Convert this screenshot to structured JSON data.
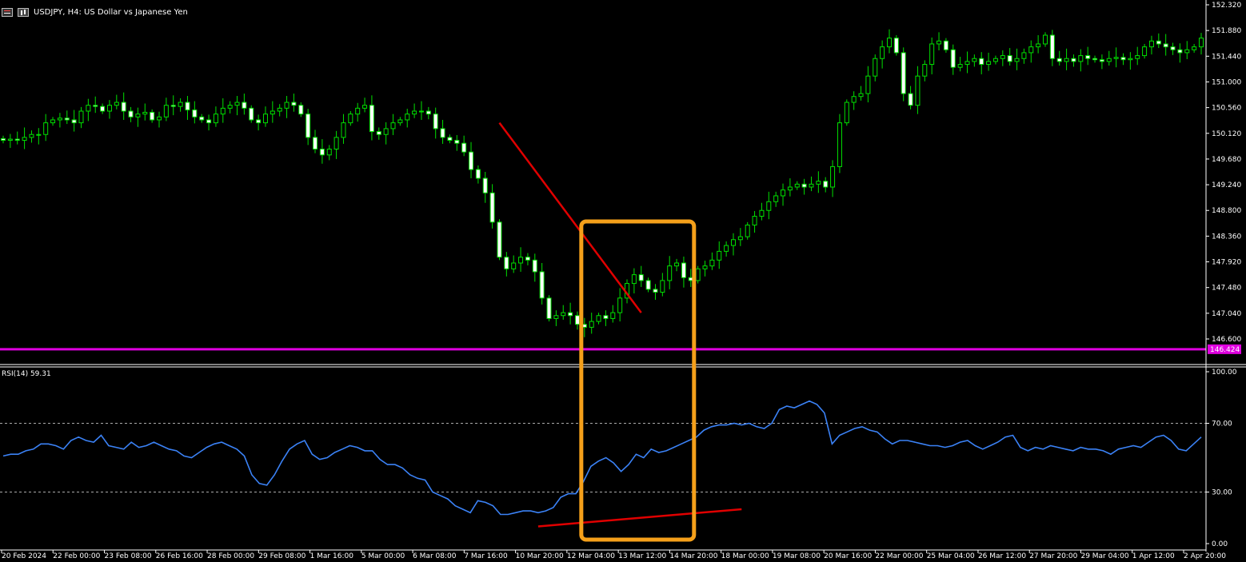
{
  "window": {
    "symbol_title": "USDJPY, H4:  US Dollar vs Japanese Yen",
    "menu_icons": [
      "grid-menu-icon",
      "chart-menu-icon"
    ]
  },
  "price_axis": {
    "min": 146.6,
    "max": 152.32,
    "ticks": [
      "152.320",
      "151.880",
      "151.440",
      "151.000",
      "150.560",
      "150.120",
      "149.680",
      "149.240",
      "148.800",
      "148.360",
      "147.920",
      "147.480",
      "147.040",
      "146.600"
    ],
    "hline_label": "146.424",
    "hline_value": 146.424
  },
  "rsi": {
    "label": "RSI(14) 59.31",
    "ticks": [
      "100.00",
      "70.00",
      "30.00",
      "0.00"
    ],
    "levels": [
      70,
      30
    ]
  },
  "time_axis": {
    "labels": [
      "20 Feb 2024",
      "22 Feb 00:00",
      "23 Feb 08:00",
      "26 Feb 16:00",
      "28 Feb 00:00",
      "29 Feb 08:00",
      "1 Mar 16:00",
      "5 Mar 00:00",
      "6 Mar 08:00",
      "7 Mar 16:00",
      "10 Mar 20:00",
      "12 Mar 04:00",
      "13 Mar 12:00",
      "14 Mar 20:00",
      "18 Mar 00:00",
      "19 Mar 08:00",
      "20 Mar 16:00",
      "22 Mar 00:00",
      "25 Mar 04:00",
      "26 Mar 12:00",
      "27 Mar 20:00",
      "29 Mar 04:00",
      "1 Apr 12:00",
      "2 Apr 20:00"
    ]
  },
  "colors": {
    "background": "#000000",
    "bull_body": "#000000",
    "bull_wick": "#00e000",
    "bear_body": "#ffffff",
    "rsi_line": "#3b82f6",
    "trendline": "#e00000",
    "highlight_box": "#f5a01a",
    "hline": "#e000e0",
    "grid_text": "#ffffff"
  },
  "chart_data": {
    "type": "candlestick",
    "timeframe": "H4",
    "close_series": [
      150.0,
      150.02,
      150.0,
      150.05,
      150.1,
      150.1,
      150.3,
      150.35,
      150.38,
      150.35,
      150.3,
      150.5,
      150.6,
      150.58,
      150.5,
      150.6,
      150.65,
      150.5,
      150.4,
      150.45,
      150.48,
      150.35,
      150.4,
      150.6,
      150.58,
      150.65,
      150.52,
      150.4,
      150.35,
      150.3,
      150.45,
      150.55,
      150.6,
      150.65,
      150.55,
      150.35,
      150.3,
      150.45,
      150.5,
      150.55,
      150.65,
      150.6,
      150.45,
      150.05,
      149.85,
      149.75,
      149.85,
      150.05,
      150.3,
      150.45,
      150.55,
      150.6,
      150.15,
      150.1,
      150.2,
      150.3,
      150.35,
      150.45,
      150.5,
      150.5,
      150.45,
      150.2,
      150.05,
      150.0,
      149.95,
      149.8,
      149.5,
      149.35,
      149.1,
      148.6,
      148.0,
      147.8,
      147.9,
      148.0,
      147.95,
      147.75,
      147.3,
      146.95,
      147.0,
      147.05,
      147.0,
      146.85,
      146.8,
      146.9,
      147.0,
      146.95,
      147.05,
      147.3,
      147.55,
      147.7,
      147.6,
      147.45,
      147.4,
      147.6,
      147.85,
      147.9,
      147.65,
      147.6,
      147.8,
      147.85,
      147.95,
      148.1,
      148.2,
      148.3,
      148.35,
      148.55,
      148.7,
      148.8,
      148.95,
      149.05,
      149.15,
      149.2,
      149.25,
      149.2,
      149.25,
      149.3,
      149.2,
      149.55,
      150.3,
      150.65,
      150.75,
      150.8,
      151.1,
      151.4,
      151.6,
      151.75,
      151.5,
      150.8,
      150.6,
      151.1,
      151.3,
      151.65,
      151.7,
      151.55,
      151.25,
      151.3,
      151.35,
      151.4,
      151.3,
      151.35,
      151.4,
      151.45,
      151.35,
      151.4,
      151.5,
      151.6,
      151.65,
      151.8,
      151.4,
      151.35,
      151.4,
      151.35,
      151.45,
      151.4,
      151.38,
      151.35,
      151.4,
      151.42,
      151.38,
      151.4,
      151.45,
      151.6,
      151.7,
      151.65,
      151.6,
      151.55,
      151.5,
      151.55,
      151.6,
      151.75
    ],
    "rsi_series": [
      51,
      52,
      52,
      54,
      55,
      58,
      58,
      57,
      55,
      60,
      62,
      60,
      59,
      63,
      57,
      56,
      55,
      59,
      56,
      57,
      59,
      57,
      55,
      54,
      51,
      50,
      53,
      56,
      58,
      59,
      57,
      55,
      51,
      40,
      35,
      34,
      40,
      48,
      55,
      58,
      60,
      52,
      49,
      50,
      53,
      55,
      57,
      56,
      54,
      54,
      49,
      46,
      46,
      44,
      40,
      38,
      37,
      30,
      28,
      26,
      22,
      20,
      18,
      25,
      24,
      22,
      17,
      17,
      18,
      19,
      19,
      18,
      19,
      21,
      27,
      29,
      29,
      36,
      45,
      48,
      50,
      47,
      42,
      46,
      52,
      50,
      55,
      53,
      54,
      56,
      58,
      60,
      62,
      66,
      68,
      69,
      69,
      70,
      69,
      70,
      68,
      67,
      70,
      78,
      80,
      79,
      81,
      83,
      81,
      76,
      58,
      63,
      65,
      67,
      68,
      66,
      65,
      61,
      58,
      60,
      60,
      59,
      58,
      57,
      57,
      56,
      57,
      59,
      60,
      57,
      55,
      57,
      59,
      62,
      63,
      56,
      54,
      56,
      55,
      57,
      56,
      55,
      54,
      56,
      55,
      55,
      54,
      52,
      55,
      56,
      57,
      56,
      59,
      62,
      63,
      60,
      55,
      54,
      58,
      62
    ],
    "highlight_box_index_range": [
      82,
      97
    ],
    "price_trendline": {
      "start": {
        "index": 70,
        "value": 150.3
      },
      "end": {
        "index": 90,
        "value": 147.05
      }
    },
    "rsi_trendline": {
      "start": {
        "index": 71,
        "value": 10
      },
      "end": {
        "index": 98,
        "value": 20
      }
    }
  }
}
